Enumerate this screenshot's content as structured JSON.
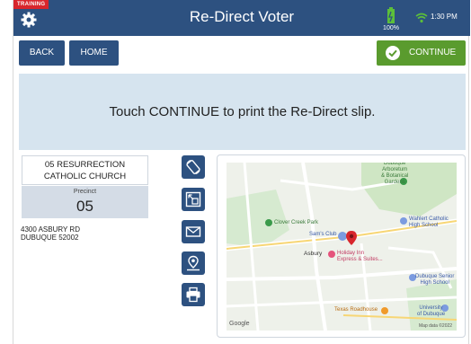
{
  "header": {
    "training_label": "TRAINING",
    "title": "Re-Direct Voter",
    "battery": "100%",
    "time": "1:30 PM"
  },
  "nav": {
    "back_label": "BACK",
    "home_label": "HOME",
    "continue_label": "CONTINUE"
  },
  "instruction": "Touch CONTINUE to print the Re-Direct slip.",
  "location": {
    "name": "05 RESURRECTION\nCATHOLIC CHURCH",
    "precinct_label": "Precinct",
    "precinct_number": "05",
    "address": "4300 ASBURY RD\nDUBUQUE 52002"
  },
  "actions": [
    {
      "icon": "rotate-icon"
    },
    {
      "icon": "expand-icon"
    },
    {
      "icon": "mail-icon"
    },
    {
      "icon": "map-pin-icon"
    },
    {
      "icon": "print-icon"
    }
  ],
  "map": {
    "labels": {
      "arboretum": "Dubuque\nArboretum\n& Botanical\nGardens",
      "clover": "Clover Creek Park",
      "sams": "Sam's Club",
      "wahlert": "Wahlert Catholic\nHigh School",
      "asbury": "Asbury",
      "holiday": "Holiday Inn\nExpress & Suites...",
      "dubuque_senior": "Dubuque Senior\nHigh School",
      "texas": "Texas Roadhouse",
      "university": "University\nof Dubuque",
      "google": "Google",
      "map_data": "Map data ©2022"
    }
  },
  "colors": {
    "header": "#2d5180",
    "continue": "#5a9b2e",
    "banner": "#d6e4ef",
    "training": "#d8262c"
  }
}
